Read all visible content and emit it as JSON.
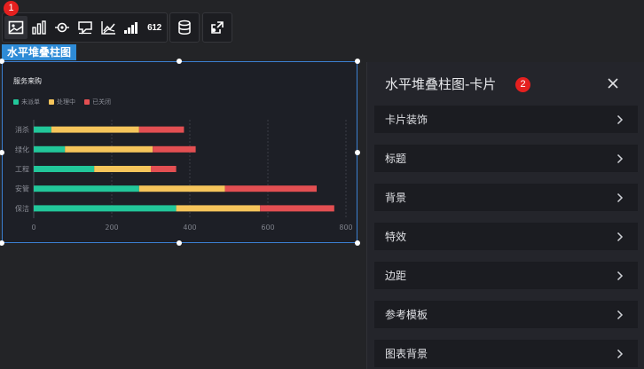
{
  "toolbar": {
    "group1_icons": [
      "image-icon",
      "bar-chart-icon",
      "eye-target-icon",
      "card-flag-icon",
      "line-chart-icon",
      "stepped-bar-icon",
      "number-icon"
    ],
    "number_icon_text": "612",
    "group2_icons": [
      "database-icon"
    ],
    "group3_icons": [
      "link-icon"
    ],
    "badge_1": "1"
  },
  "tag_label": "水平堆叠柱图",
  "chart_data": {
    "type": "bar",
    "orientation": "horizontal",
    "stacked": true,
    "title": "服务来购",
    "categories": [
      "消杀",
      "绿化",
      "工程",
      "安管",
      "保洁"
    ],
    "series": [
      {
        "name": "未派单",
        "color": "#22c79a",
        "values": [
          45,
          80,
          155,
          270,
          365
        ]
      },
      {
        "name": "处理中",
        "color": "#f6c55b",
        "values": [
          225,
          225,
          145,
          220,
          215
        ]
      },
      {
        "name": "已关闭",
        "color": "#e34f52",
        "values": [
          115,
          110,
          65,
          235,
          190
        ]
      }
    ],
    "x_ticks": [
      "0",
      "200",
      "400",
      "600",
      "800"
    ],
    "xlim": [
      0,
      800
    ],
    "grid": "vertical-dashed",
    "legend": "top-left"
  },
  "panel": {
    "title": "水平堆叠柱图-卡片",
    "badge_2": "2",
    "items": [
      "卡片装饰",
      "标题",
      "背景",
      "特效",
      "边距",
      "参考模板",
      "图表背景"
    ]
  }
}
